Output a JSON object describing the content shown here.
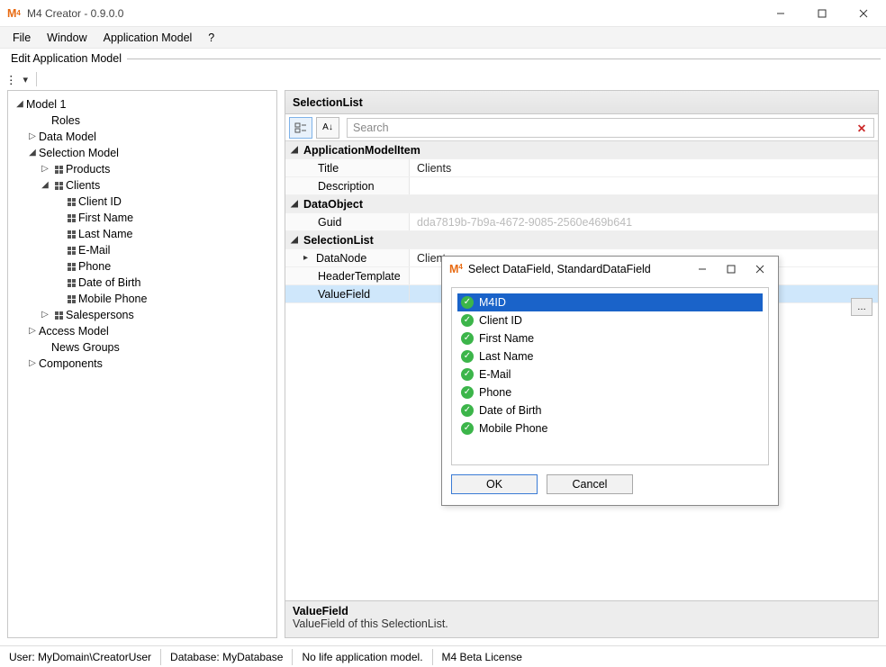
{
  "window": {
    "title": "M4 Creator - 0.9.0.0",
    "app_icon_text": "M"
  },
  "menubar": {
    "file": "File",
    "window": "Window",
    "app_model": "Application Model",
    "help": "?"
  },
  "doc_title": "Edit Application Model",
  "tree": {
    "root": "Model 1",
    "roles": "Roles",
    "data_model": "Data Model",
    "selection_model": "Selection Model",
    "products": "Products",
    "clients": "Clients",
    "client_fields": {
      "client_id": "Client ID",
      "first_name": "First Name",
      "last_name": "Last Name",
      "email": "E-Mail",
      "phone": "Phone",
      "dob": "Date of Birth",
      "mobile": "Mobile Phone"
    },
    "salespersons": "Salespersons",
    "access_model": "Access Model",
    "news_groups": "News Groups",
    "components": "Components"
  },
  "right": {
    "header": "SelectionList",
    "search_placeholder": "Search",
    "groups": {
      "g1": "ApplicationModelItem",
      "g1_title_k": "Title",
      "g1_title_v": "Clients",
      "g1_desc_k": "Description",
      "g1_desc_v": "",
      "g2": "DataObject",
      "g2_guid_k": "Guid",
      "g2_guid_v": "dda7819b-7b9a-4672-9085-2560e469b641",
      "g3": "SelectionList",
      "g3_dn_k": "DataNode",
      "g3_dn_v": "Clients",
      "g3_ht_k": "HeaderTemplate",
      "g3_ht_v": "",
      "g3_vf_k": "ValueField",
      "g3_vf_v": ""
    },
    "footer_title": "ValueField",
    "footer_desc": "ValueField of this SelectionList."
  },
  "dialog": {
    "title": "Select DataField, StandardDataField",
    "fields": {
      "m4id": "M4ID",
      "client_id": "Client ID",
      "first_name": "First Name",
      "last_name": "Last Name",
      "email": "E-Mail",
      "phone": "Phone",
      "dob": "Date of Birth",
      "mobile": "Mobile Phone"
    },
    "ok": "OK",
    "cancel": "Cancel"
  },
  "status": {
    "user": "User: MyDomain\\CreatorUser",
    "db": "Database: MyDatabase",
    "life": "No life application model.",
    "lic": "M4 Beta License"
  }
}
